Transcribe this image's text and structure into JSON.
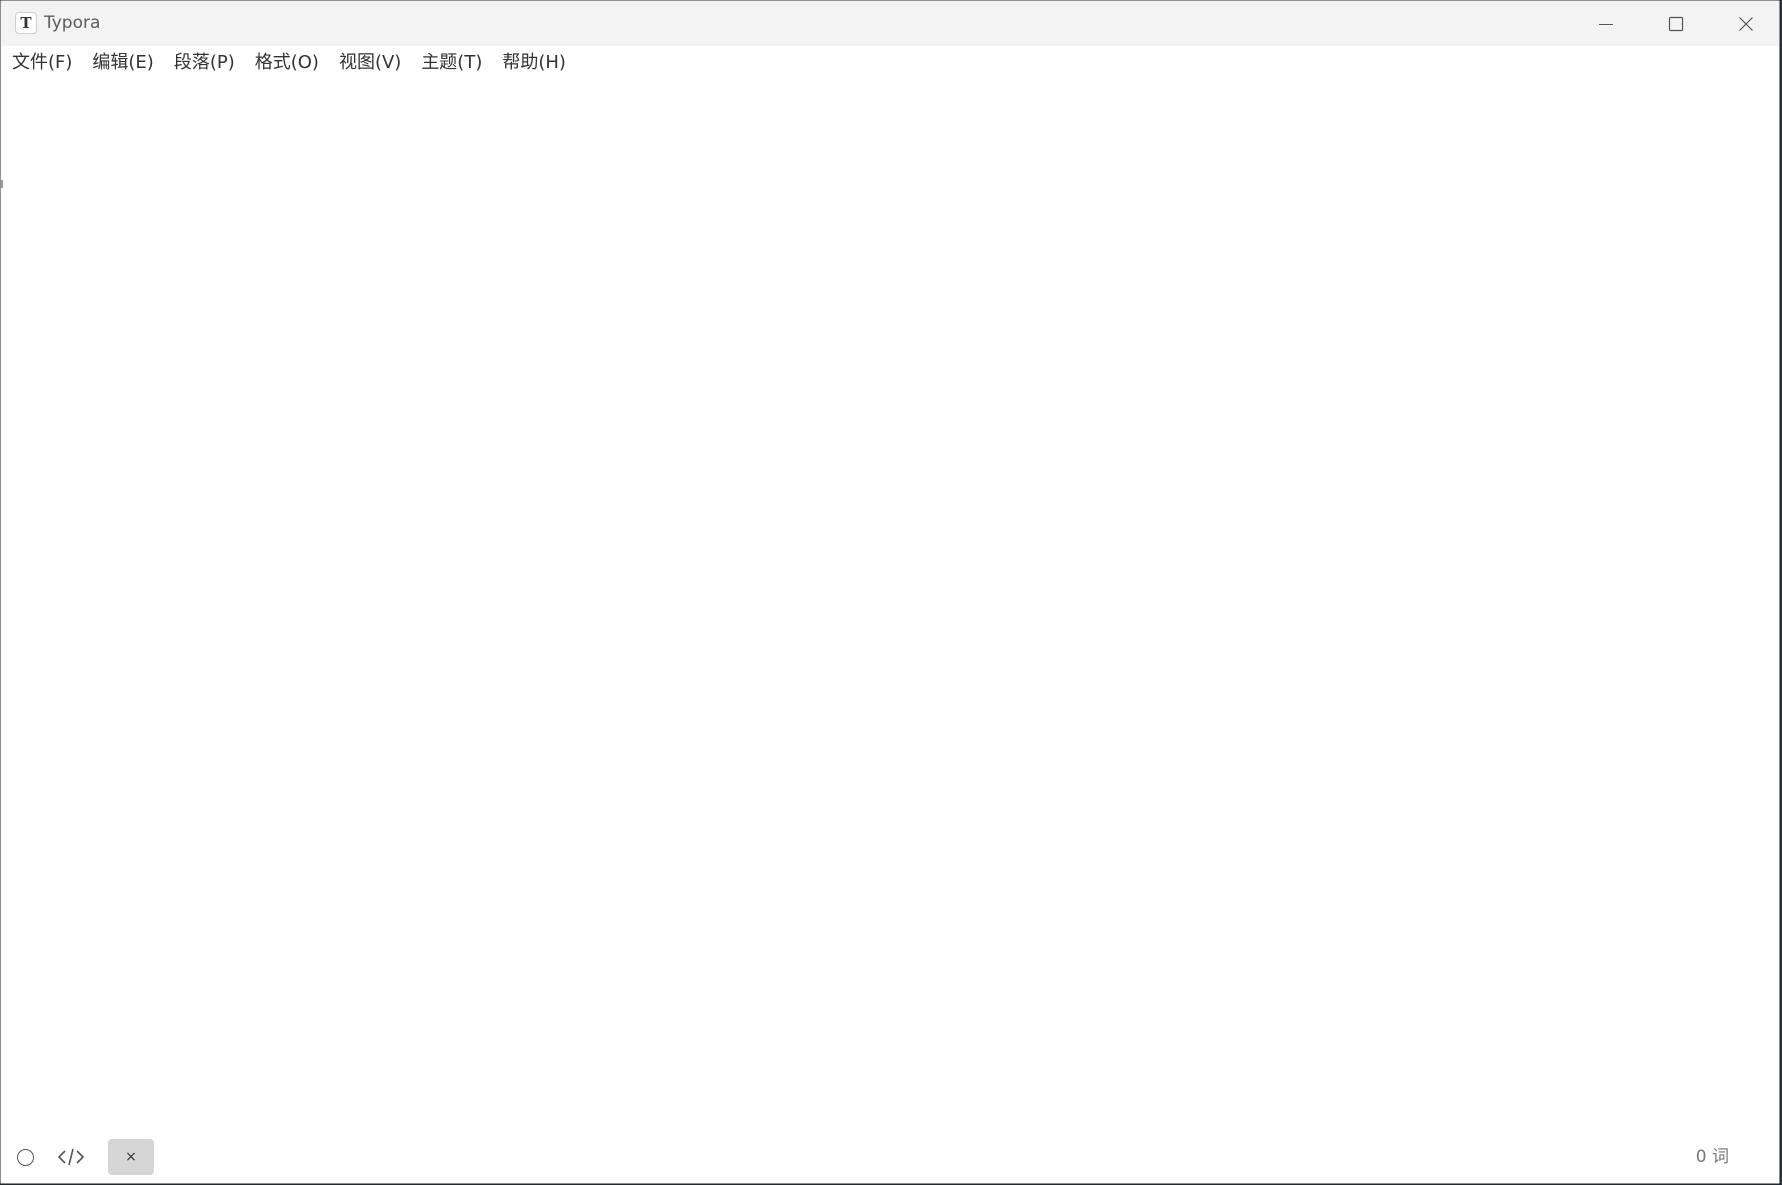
{
  "window": {
    "title": "Typora",
    "app_icon_letter": "T"
  },
  "menu": {
    "items": [
      {
        "label": "文件(F)"
      },
      {
        "label": "编辑(E)"
      },
      {
        "label": "段落(P)"
      },
      {
        "label": "格式(O)"
      },
      {
        "label": "视图(V)"
      },
      {
        "label": "主题(T)"
      },
      {
        "label": "帮助(H)"
      }
    ]
  },
  "statusbar": {
    "close_label": "×",
    "word_count": "0 词",
    "icons": [
      "outline-circle-icon",
      "source-code-icon"
    ]
  },
  "colors": {
    "titlebar_bg": "#f3f3f3",
    "editor_bg": "#ffffff",
    "status_close_bg": "#d6d6d6"
  }
}
